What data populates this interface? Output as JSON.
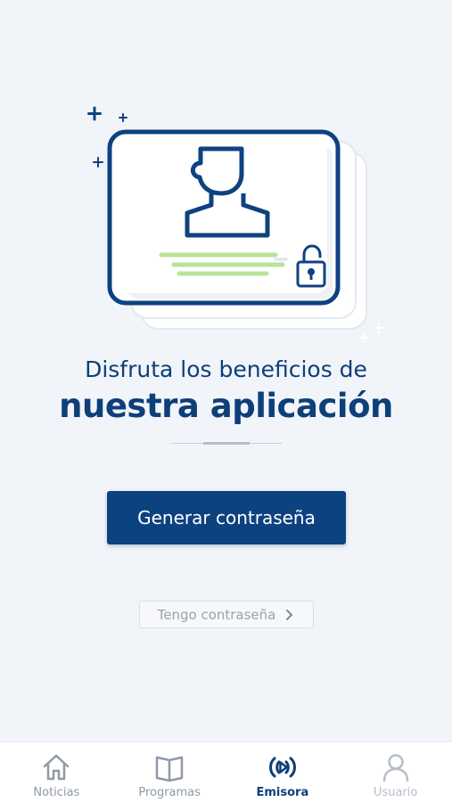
{
  "headline": {
    "line1": "Disfruta los beneficios de",
    "line2": "nuestra aplicación"
  },
  "actions": {
    "primary_label": "Generar contraseña",
    "secondary_label": "Tengo contraseña"
  },
  "bottom_nav": {
    "items": [
      {
        "label": "Noticias",
        "icon": "home-icon",
        "state": "inactive"
      },
      {
        "label": "Programas",
        "icon": "book-icon",
        "state": "inactive"
      },
      {
        "label": "Emisora",
        "icon": "radio-play-icon",
        "state": "active"
      },
      {
        "label": "Usuario",
        "icon": "user-icon",
        "state": "disabled"
      }
    ]
  },
  "colors": {
    "background": "#f1f4f9",
    "brand_navy": "#0d4280",
    "accent_green": "#b9e29a",
    "nav_inactive": "#8e9aa8"
  }
}
